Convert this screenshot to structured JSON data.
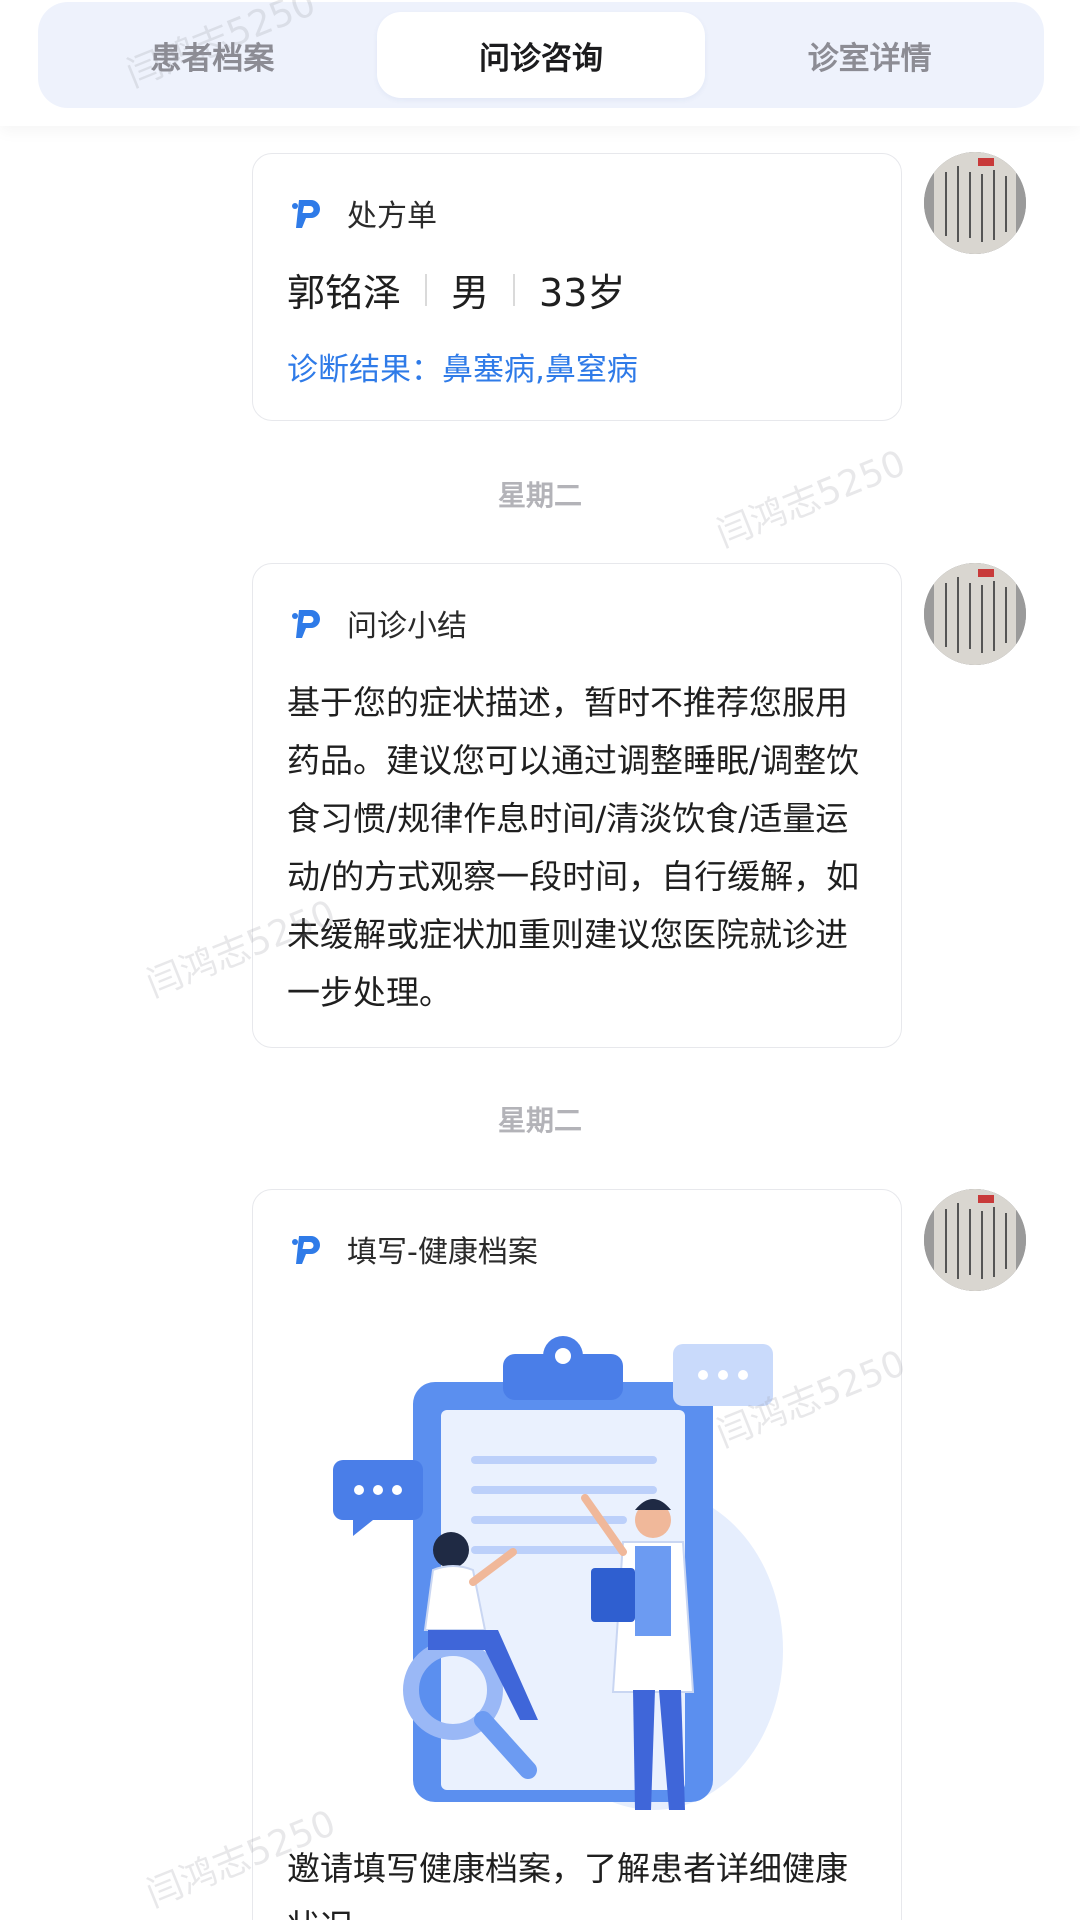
{
  "tabs": [
    {
      "label": "患者档案",
      "active": false
    },
    {
      "label": "问诊咨询",
      "active": true
    },
    {
      "label": "诊室详情",
      "active": false
    }
  ],
  "prescription": {
    "title": "处方单",
    "patient_name": "郭铭泽",
    "gender": "男",
    "age": "33岁",
    "diagnosis": "诊断结果：鼻塞病,鼻窒病"
  },
  "separators": [
    "星期二",
    "星期二"
  ],
  "summary": {
    "title": "问诊小结",
    "text": "基于您的症状描述，暂时不推荐您服用药品。建议您可以通过调整睡眠/调整饮食习惯/规律作息时间/清淡饮食/适量运动/的方式观察一段时间，自行缓解，如未缓解或症状加重则建议您医院就诊进一步处理。"
  },
  "health_record": {
    "title": "填写-健康档案",
    "text": "邀请填写健康档案，了解患者详细健康状况"
  },
  "watermark": "闫鸿志5250",
  "colors": {
    "accent": "#2f7be8",
    "tabbar_bg": "#eef2fc",
    "illustration_blue": "#5b8fef"
  }
}
